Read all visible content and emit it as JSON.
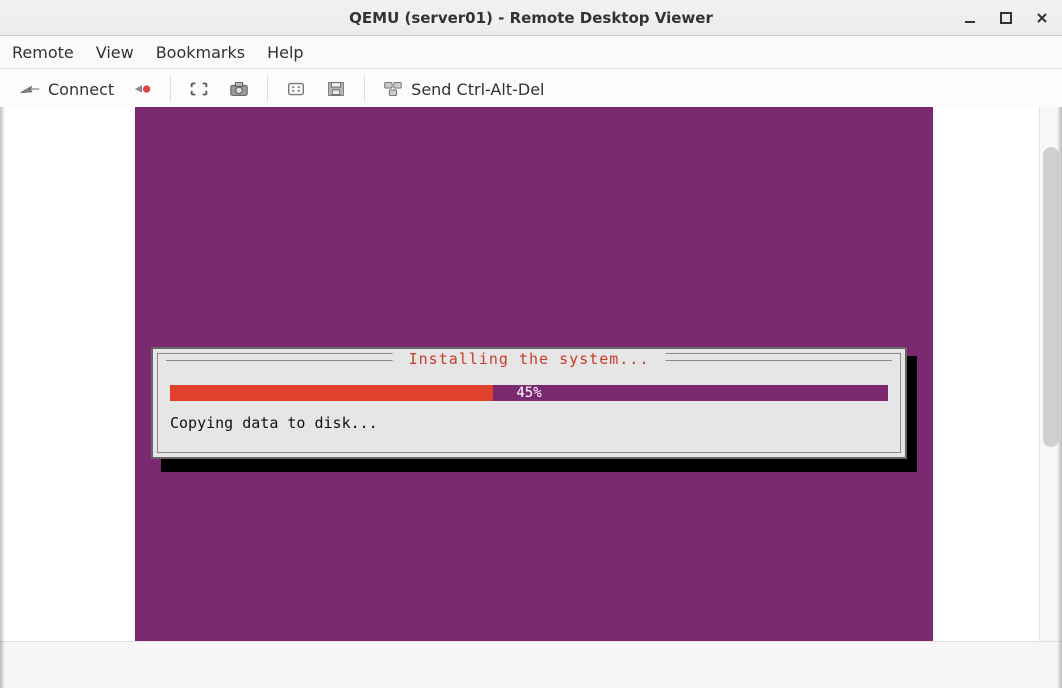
{
  "window": {
    "title": "QEMU (server01) - Remote Desktop Viewer"
  },
  "menubar": {
    "items": [
      "Remote",
      "View",
      "Bookmarks",
      "Help"
    ]
  },
  "toolbar": {
    "connect_label": "Connect",
    "send_cad_label": "Send Ctrl-Alt-Del"
  },
  "installer": {
    "title": " Installing the system... ",
    "progress_pct": 45,
    "progress_label": "45%",
    "status": "Copying data to disk..."
  },
  "colors": {
    "remote_bg": "#7b2a72",
    "progress_fill": "#e0412c",
    "title_red": "#c73b2a"
  },
  "chart_data": {
    "type": "bar",
    "categories": [
      "progress"
    ],
    "values": [
      45
    ],
    "ylim": [
      0,
      100
    ],
    "title": "Installing the system...",
    "ylabel": "%",
    "xlabel": ""
  }
}
